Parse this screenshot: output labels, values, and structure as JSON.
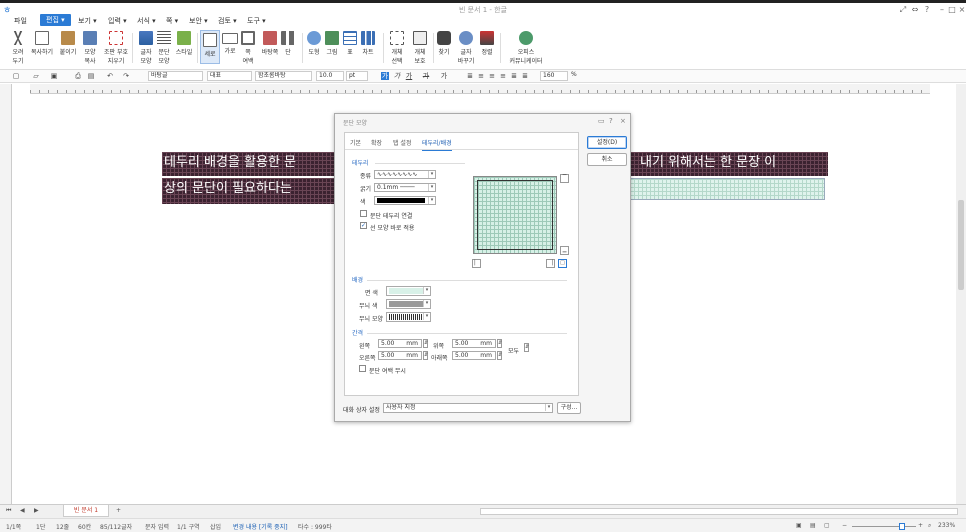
{
  "window": {
    "title": "빈 문서 1 - 한글",
    "help": "?"
  },
  "menu": [
    "파일",
    "편집",
    "보기",
    "입력",
    "서식",
    "쪽",
    "보안",
    "검토",
    "도구"
  ],
  "ribbon": [
    {
      "label": "오려\n두기",
      "icon": "scissors-icon"
    },
    {
      "label": "복사하기",
      "icon": "copy-icon"
    },
    {
      "label": "붙이기",
      "icon": "paste-icon"
    },
    {
      "label": "모양\n복사",
      "icon": "format-painter-icon"
    },
    {
      "label": "조판 부호\n지우기",
      "icon": "erase-codes-icon"
    },
    {
      "label": "글자\n모양",
      "icon": "char-shape-icon"
    },
    {
      "label": "문단\n모양",
      "icon": "para-shape-icon"
    },
    {
      "label": "스타일",
      "icon": "style-icon"
    },
    {
      "label": "세로",
      "icon": "vertical-icon"
    },
    {
      "label": "가로",
      "icon": "horizontal-icon"
    },
    {
      "label": "쪽\n여백",
      "icon": "page-margin-icon"
    },
    {
      "label": "바탕쪽",
      "icon": "master-page-icon"
    },
    {
      "label": "단",
      "icon": "columns-icon"
    },
    {
      "label": "도형",
      "icon": "shape-icon"
    },
    {
      "label": "그림",
      "icon": "picture-icon"
    },
    {
      "label": "표",
      "icon": "table-icon"
    },
    {
      "label": "차트",
      "icon": "chart-icon"
    },
    {
      "label": "개체\n선택",
      "icon": "select-object-icon"
    },
    {
      "label": "개체\n보호",
      "icon": "protect-object-icon"
    },
    {
      "label": "찾기",
      "icon": "find-icon"
    },
    {
      "label": "글자\n바꾸기",
      "icon": "replace-icon"
    },
    {
      "label": "정렬",
      "icon": "sort-icon"
    },
    {
      "label": "오피스\n커뮤니케이터",
      "icon": "communicator-icon"
    }
  ],
  "format_bar": {
    "style": "바탕글",
    "lang": "대표",
    "font": "함초롬바탕",
    "size": "10.0",
    "unit": "pt",
    "zoom": "160",
    "zoom_unit": "%",
    "bold": "가",
    "italic": "가",
    "underline": "가",
    "strike": "가",
    "super": "가"
  },
  "document": {
    "line1_left": "테두리 배경을 활용한 문",
    "line1_right": "내기 위해서는 한 문장 이",
    "line2": "상의 문단이 필요하다는"
  },
  "dialog": {
    "title": "문단 모양",
    "help": "?",
    "close": "×",
    "tabs": [
      "기본",
      "확장",
      "탭 설정",
      "테두리/배경"
    ],
    "active_tab": "테두리/배경",
    "border": {
      "section": "테두리",
      "type_label": "종류",
      "type_value": "∿∿∿∿∿∿∿∿",
      "width_label": "굵기",
      "width_value": "0.1mm",
      "color_label": "색",
      "connect_label": "문단 테두리 연결",
      "connect_checked": false,
      "apply_label": "선 모양 바로 적용",
      "apply_checked": true
    },
    "background": {
      "section": "배경",
      "face_label": "면 색",
      "pattern_color_label": "무늬 색",
      "pattern_label": "무늬 모양",
      "face_color": "#d8f1e8",
      "pattern_color": "#9a9a9a"
    },
    "spacing": {
      "section": "간격",
      "left_label": "왼쪽",
      "left_value": "5.00",
      "left_unit": "mm",
      "top_label": "위쪽",
      "top_value": "5.00",
      "top_unit": "mm",
      "right_label": "오른쪽",
      "right_value": "5.00",
      "right_unit": "mm",
      "bottom_label": "아래쪽",
      "bottom_value": "5.00",
      "bottom_unit": "mm",
      "all_label": "모두",
      "ignore_label": "문단 여백 무시",
      "ignore_checked": false
    },
    "style_label": "대화 상자 설정",
    "style_value": "사용자 지정",
    "config_label": "구성...",
    "ok_label": "설정(D)",
    "cancel_label": "취소"
  },
  "tabs": {
    "doc": "빈 문서 1",
    "add": "+"
  },
  "status": [
    "1/1쪽",
    "1단",
    "12줄",
    "60칸",
    "85/112글자",
    "문자 입력",
    "1/1 구역",
    "삽입",
    "변경 내용 [기록 중지]",
    "타수 : 999타"
  ],
  "zoom_status": "233%",
  "colors": {
    "accent": "#2b7bd5",
    "band": "#3b2230",
    "green": "#dff3ec"
  }
}
